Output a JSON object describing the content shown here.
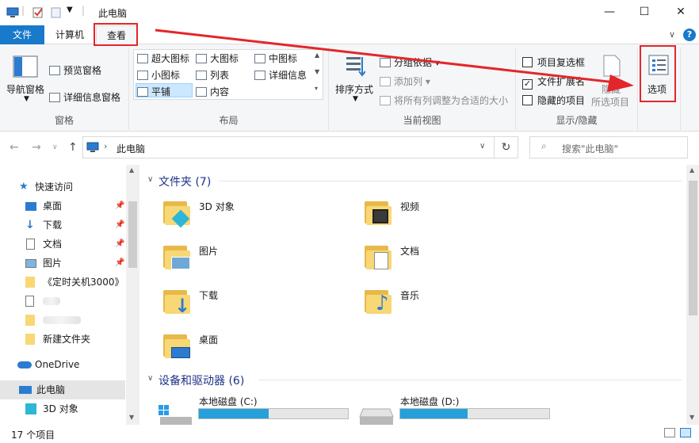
{
  "window": {
    "title": "此电脑",
    "controls": {
      "minimize": "—",
      "maximize": "☐",
      "close": "✕"
    }
  },
  "tabs": {
    "file": "文件",
    "computer": "计算机",
    "view": "查看"
  },
  "ribbon": {
    "panes": {
      "nav_pane": "导航窗格",
      "preview_pane": "预览窗格",
      "details_pane": "详细信息窗格",
      "label": "窗格"
    },
    "layout": {
      "extra_large": "超大图标",
      "large": "大图标",
      "medium": "中图标",
      "small": "小图标",
      "list": "列表",
      "details": "详细信息",
      "tiles": "平铺",
      "content": "内容",
      "label": "布局"
    },
    "current_view": {
      "sort_by": "排序方式",
      "group_by": "分组依据",
      "add_columns": "添加列",
      "size_all_columns": "将所有列调整为合适的大小",
      "label": "当前视图"
    },
    "show_hide": {
      "item_checkboxes": "项目复选框",
      "file_extensions": "文件扩展名",
      "hidden_items": "隐藏的项目",
      "hide_selected": "隐藏",
      "hide_selected_2": "所选项目",
      "label": "显示/隐藏"
    },
    "options": "选项"
  },
  "address": {
    "path": "此电脑",
    "search_placeholder": "搜索\"此电脑\""
  },
  "nav": {
    "quick_access": "快速访问",
    "items": [
      "桌面",
      "下载",
      "文档",
      "图片",
      "《定时关机3000》",
      "",
      "",
      "新建文件夹"
    ],
    "onedrive": "OneDrive",
    "this_pc": "此电脑",
    "objects_3d": "3D 对象"
  },
  "content": {
    "folders_header": "文件夹 (7)",
    "folders": [
      "3D 对象",
      "视频",
      "图片",
      "文档",
      "下载",
      "音乐",
      "桌面"
    ],
    "drives_header": "设备和驱动器 (6)",
    "drives": [
      {
        "name": "本地磁盘 (C:)",
        "used_fraction": 0.47
      },
      {
        "name": "本地磁盘 (D:)",
        "used_fraction": 0.45
      }
    ]
  },
  "status": {
    "count": "17 个项目"
  },
  "colors": {
    "accent": "#1979ca",
    "highlight_red": "#e3262b",
    "folder": "#f8d775"
  }
}
